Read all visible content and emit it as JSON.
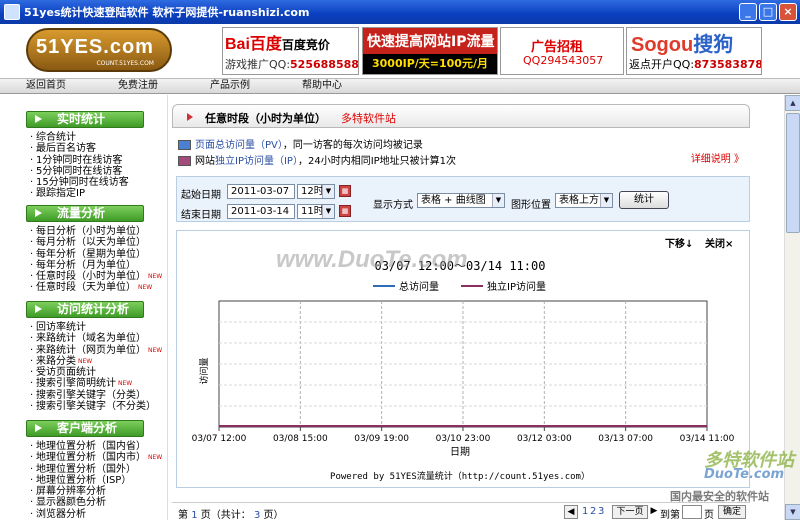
{
  "window": {
    "title": "51yes统计快速登陆软件 软杯子网提供-ruanshizi.com"
  },
  "banner": {
    "logo_text": "51YES.com",
    "logo_sub": "COUNT.51YES.COM",
    "ad_baidu_brand": "Bai百度",
    "ad_baidu_tag": "百度竞价",
    "ad_baidu_line": "游戏推广QQ:",
    "ad_baidu_qq": "525688588",
    "ad_ip_title": "快速提高网站IP流量",
    "ad_ip_line": "3000IP/天=100元/月",
    "ad_recruit_title": "广告招租",
    "ad_recruit_qq": "QQ294543057",
    "ad_sogou_brand": "Sogou",
    "ad_sogou_brand2": "搜狗",
    "ad_sogou_line": "返点开户QQ:",
    "ad_sogou_qq": "873583878"
  },
  "topnav": [
    "返回首页",
    "免费注册",
    "产品示例",
    "帮助中心"
  ],
  "sidebar": {
    "sections": [
      {
        "title": "实时统计",
        "items": [
          {
            "label": "综合统计"
          },
          {
            "label": "最后百名访客"
          },
          {
            "label": "1分钟同时在线访客"
          },
          {
            "label": "5分钟同时在线访客"
          },
          {
            "label": "15分钟同时在线访客"
          },
          {
            "label": "跟踪指定IP"
          }
        ]
      },
      {
        "title": "流量分析",
        "items": [
          {
            "label": "每日分析（小时为单位）"
          },
          {
            "label": "每月分析（以天为单位）"
          },
          {
            "label": "每年分析（星期为单位）"
          },
          {
            "label": "每年分析（月为单位）"
          },
          {
            "label": "任意时段（小时为单位）",
            "new": "NEW"
          },
          {
            "label": "任意时段（天为单位）",
            "new": "NEW"
          }
        ]
      },
      {
        "title": "访问统计分析",
        "items": [
          {
            "label": "回访率统计"
          },
          {
            "label": "来路统计（域名为单位）"
          },
          {
            "label": "来路统计（网页为单位）",
            "new": "NEW"
          },
          {
            "label": "来路分类",
            "new": "NEW"
          },
          {
            "label": "受访页面统计"
          },
          {
            "label": "搜索引擎简明统计",
            "new": "NEW"
          },
          {
            "label": "搜索引擎关键字（分类）"
          },
          {
            "label": "搜索引擎关键字（不分类）"
          }
        ]
      },
      {
        "title": "客户端分析",
        "items": [
          {
            "label": "地理位置分析（国内省）"
          },
          {
            "label": "地理位置分析（国内市）",
            "new": "NEW"
          },
          {
            "label": "地理位置分析（国外）"
          },
          {
            "label": "地理位置分析（ISP）"
          },
          {
            "label": "屏幕分辨率分析"
          },
          {
            "label": "显示器颜色分析"
          },
          {
            "label": "浏览器分析"
          }
        ]
      }
    ]
  },
  "main": {
    "tab_title": "任意时段（小时为单位）",
    "tab_sub": "多特软件站",
    "info_pv_link": "页面总访问量（PV）",
    "info_pv_text": "，同一访客的每次访问均被记录",
    "info_ip_prefix": "网站",
    "info_ip_link": "独立IP访问量（IP）",
    "info_ip_text": "，24小时内相同IP地址只被计算1次",
    "detail_link": "详细说明 》",
    "filter": {
      "start_label": "起始日期",
      "start_date": "2011-03-07",
      "start_hour": "12时",
      "end_label": "结束日期",
      "end_date": "2011-03-14",
      "end_hour": "11时",
      "mode_label": "显示方式",
      "mode_value": "表格 + 曲线图",
      "pos_label": "图形位置",
      "pos_value": "表格上方",
      "submit": "统计"
    },
    "chart_actions": {
      "down": "下移↓",
      "close": "关闭×"
    },
    "powered_by": "Powered by 51YES流量统计（http://count.51yes.com）",
    "pager": {
      "prefix": "第",
      "page": "1",
      "mid": "页（共计：",
      "total": "3",
      "suffix": "页）",
      "nums": [
        "1",
        "2",
        "3"
      ],
      "next": "下一页",
      "goto": "到第",
      "page_unit": "页",
      "confirm": "确定"
    }
  },
  "chart_data": {
    "type": "line",
    "title": "03/07 12:00～03/14 11:00",
    "xlabel": "日期",
    "ylabel": "访问量",
    "x": [
      "03/07 12:00",
      "03/08 15:00",
      "03/09 19:00",
      "03/10 23:00",
      "03/12 03:00",
      "03/13 07:00",
      "03/14 11:00"
    ],
    "series": [
      {
        "name": "总访问量",
        "color": "#2f6db5",
        "values": [
          0,
          0,
          0,
          0,
          0,
          0,
          0
        ]
      },
      {
        "name": "独立IP访问量",
        "color": "#8a2f5f",
        "values": [
          0,
          0,
          0,
          0,
          0,
          0,
          0
        ]
      }
    ],
    "grid": true,
    "legend": "top-center"
  },
  "watermarks": {
    "center": "www.DuoTe.com",
    "corner1": "多特软件站",
    "corner2": "DuoTe.com",
    "corner3": "国内最安全的软件站"
  }
}
